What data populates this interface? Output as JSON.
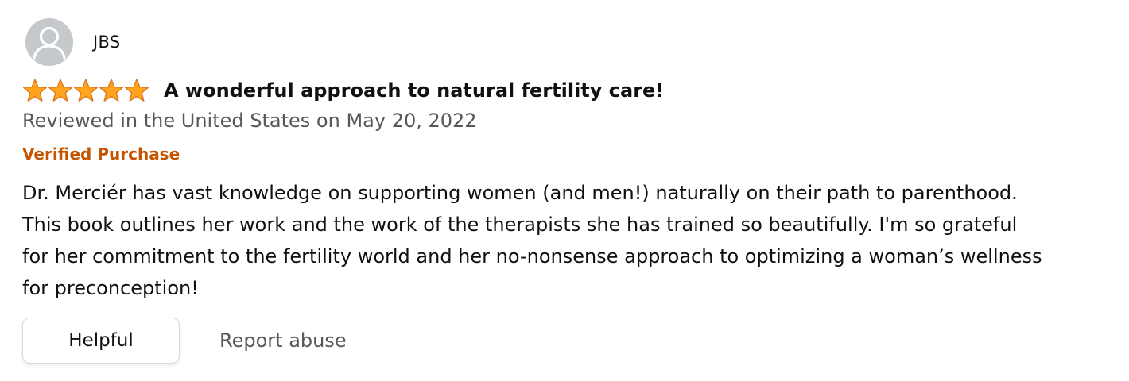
{
  "reviewer": {
    "name": "JBS",
    "avatar_icon": "user-silhouette-icon"
  },
  "rating": {
    "stars": 5,
    "max": 5,
    "star_color": "#ffa41c",
    "star_outline_color": "#de7921"
  },
  "review": {
    "title": "A wonderful approach to natural fertility care!",
    "date_text": "Reviewed in the United States on May 20, 2022",
    "verified_label": "Verified Purchase",
    "body_lines": [
      "Dr. Merciér has vast knowledge on supporting women (and men!) naturally on their path to parenthood.",
      "This book outlines her work and the work of the therapists she has trained so beautifully. I'm so grateful",
      "for her commitment to the fertility world and her no-nonsense approach to optimizing a woman’s wellness",
      "for preconception!"
    ]
  },
  "actions": {
    "helpful_label": "Helpful",
    "report_label": "Report abuse"
  },
  "colors": {
    "verified": "#c45500",
    "secondary_text": "#565959",
    "primary_text": "#0f1111",
    "avatar_bg": "#c5c9cc"
  }
}
